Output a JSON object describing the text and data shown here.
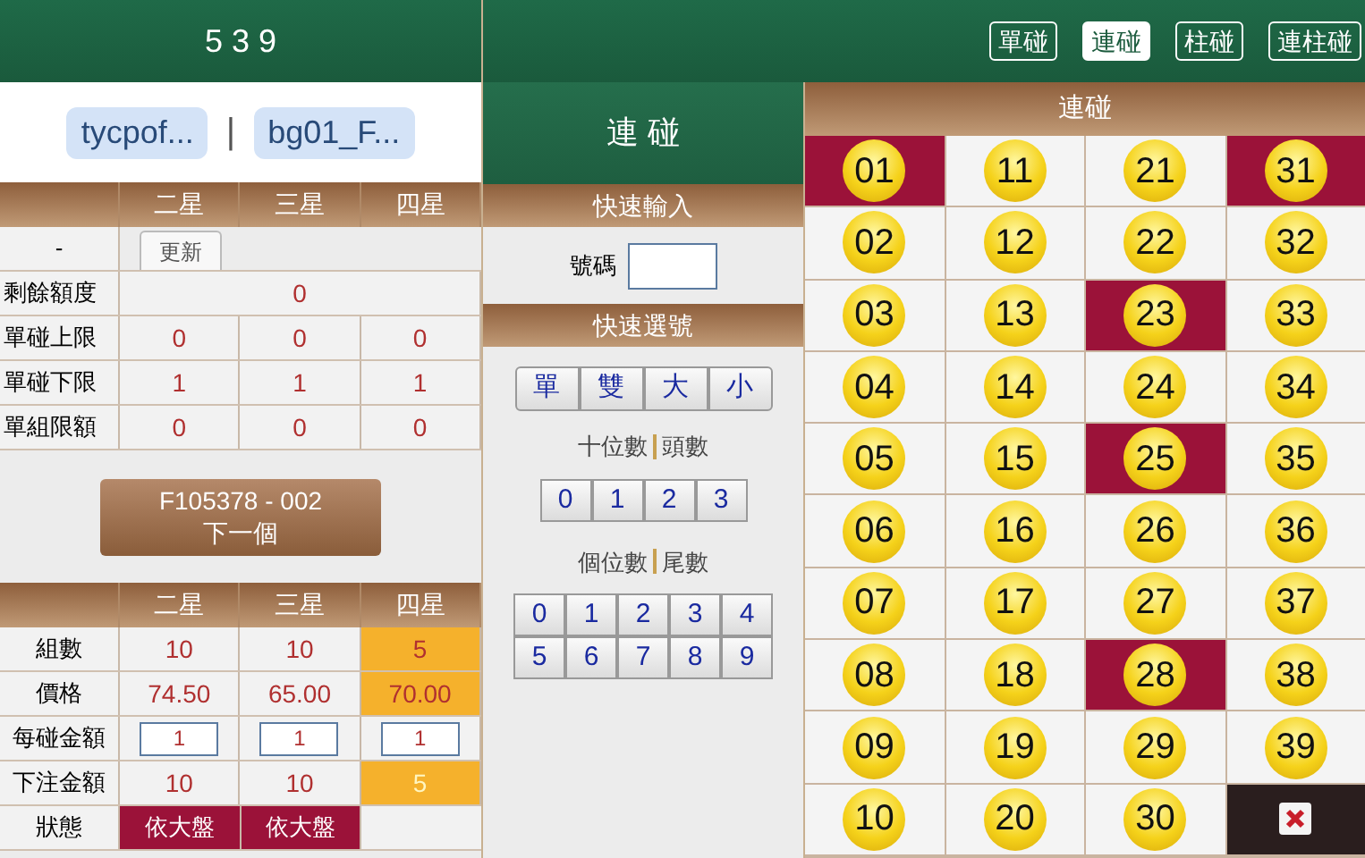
{
  "header": {
    "title": "5 3 9"
  },
  "accounts": {
    "names": [
      "tycpof...",
      "bg01_F..."
    ],
    "separator": "|"
  },
  "limits": {
    "columns": [
      "二星",
      "三星",
      "四星"
    ],
    "first_label": "-",
    "refresh_tab": "更新",
    "rows": [
      {
        "label": "剩餘額度",
        "values": [
          "0"
        ]
      },
      {
        "label": "單碰上限",
        "values": [
          "0",
          "0",
          "0"
        ]
      },
      {
        "label": "單碰下限",
        "values": [
          "1",
          "1",
          "1"
        ]
      },
      {
        "label": "單組限額",
        "values": [
          "0",
          "0",
          "0"
        ]
      }
    ]
  },
  "next_button": {
    "code": "F105378 - 002",
    "label": "下一個"
  },
  "bet_table": {
    "columns": [
      "二星",
      "三星",
      "四星"
    ],
    "rows": [
      {
        "label": "組數",
        "kind": "text",
        "cells": [
          {
            "text": "10",
            "highlighted": false
          },
          {
            "text": "10",
            "highlighted": false
          },
          {
            "text": "5",
            "highlighted": true
          }
        ]
      },
      {
        "label": "價格",
        "kind": "text",
        "cells": [
          {
            "text": "74.50",
            "highlighted": false
          },
          {
            "text": "65.00",
            "highlighted": false
          },
          {
            "text": "70.00",
            "highlighted": true
          }
        ]
      },
      {
        "label": "每碰金額",
        "kind": "input",
        "cells": [
          {
            "text": "1",
            "highlighted": false
          },
          {
            "text": "1",
            "highlighted": false
          },
          {
            "text": "1",
            "highlighted": false
          }
        ]
      },
      {
        "label": "下注金額",
        "kind": "total",
        "cells": [
          {
            "text": "10",
            "highlighted": false
          },
          {
            "text": "10",
            "highlighted": false
          },
          {
            "text": "5",
            "highlighted": true
          }
        ]
      },
      {
        "label": "狀態",
        "kind": "status",
        "cells": [
          {
            "text": "依大盤"
          },
          {
            "text": "依大盤"
          },
          {}
        ]
      }
    ]
  },
  "top_tabs": [
    {
      "label": "單碰",
      "selected": false
    },
    {
      "label": "連碰",
      "selected": true
    },
    {
      "label": "柱碰",
      "selected": false
    },
    {
      "label": "連柱碰",
      "selected": false
    }
  ],
  "mode_title": "連 碰",
  "quick_input": {
    "title": "快速輸入",
    "label": "號碼"
  },
  "quick_select": {
    "title": "快速選號",
    "parity": [
      "單",
      "雙",
      "大",
      "小"
    ],
    "tens_title": [
      "十位數",
      "頭數"
    ],
    "tens": [
      "0",
      "1",
      "2",
      "3"
    ],
    "units_title": [
      "個位數",
      "尾數"
    ],
    "units": [
      "0",
      "1",
      "2",
      "3",
      "4",
      "5",
      "6",
      "7",
      "8",
      "9"
    ]
  },
  "grid": {
    "title": "連碰",
    "cells": [
      {
        "kind": "ball",
        "text": "01",
        "selected": true
      },
      {
        "kind": "ball",
        "text": "11",
        "selected": false
      },
      {
        "kind": "ball",
        "text": "21",
        "selected": false
      },
      {
        "kind": "ball",
        "text": "31",
        "selected": true
      },
      {
        "kind": "ball",
        "text": "02",
        "selected": false
      },
      {
        "kind": "ball",
        "text": "12",
        "selected": false
      },
      {
        "kind": "ball",
        "text": "22",
        "selected": false
      },
      {
        "kind": "ball",
        "text": "32",
        "selected": false
      },
      {
        "kind": "ball",
        "text": "03",
        "selected": false
      },
      {
        "kind": "ball",
        "text": "13",
        "selected": false
      },
      {
        "kind": "ball",
        "text": "23",
        "selected": true
      },
      {
        "kind": "ball",
        "text": "33",
        "selected": false
      },
      {
        "kind": "ball",
        "text": "04",
        "selected": false
      },
      {
        "kind": "ball",
        "text": "14",
        "selected": false
      },
      {
        "kind": "ball",
        "text": "24",
        "selected": false
      },
      {
        "kind": "ball",
        "text": "34",
        "selected": false
      },
      {
        "kind": "ball",
        "text": "05",
        "selected": false
      },
      {
        "kind": "ball",
        "text": "15",
        "selected": false
      },
      {
        "kind": "ball",
        "text": "25",
        "selected": true
      },
      {
        "kind": "ball",
        "text": "35",
        "selected": false
      },
      {
        "kind": "ball",
        "text": "06",
        "selected": false
      },
      {
        "kind": "ball",
        "text": "16",
        "selected": false
      },
      {
        "kind": "ball",
        "text": "26",
        "selected": false
      },
      {
        "kind": "ball",
        "text": "36",
        "selected": false
      },
      {
        "kind": "ball",
        "text": "07",
        "selected": false
      },
      {
        "kind": "ball",
        "text": "17",
        "selected": false
      },
      {
        "kind": "ball",
        "text": "27",
        "selected": false
      },
      {
        "kind": "ball",
        "text": "37",
        "selected": false
      },
      {
        "kind": "ball",
        "text": "08",
        "selected": false
      },
      {
        "kind": "ball",
        "text": "18",
        "selected": false
      },
      {
        "kind": "ball",
        "text": "28",
        "selected": true
      },
      {
        "kind": "ball",
        "text": "38",
        "selected": false
      },
      {
        "kind": "ball",
        "text": "09",
        "selected": false
      },
      {
        "kind": "ball",
        "text": "19",
        "selected": false
      },
      {
        "kind": "ball",
        "text": "29",
        "selected": false
      },
      {
        "kind": "ball",
        "text": "39",
        "selected": false
      },
      {
        "kind": "ball",
        "text": "10",
        "selected": false
      },
      {
        "kind": "ball",
        "text": "20",
        "selected": false
      },
      {
        "kind": "ball",
        "text": "30",
        "selected": false
      },
      {
        "kind": "clear"
      }
    ]
  }
}
